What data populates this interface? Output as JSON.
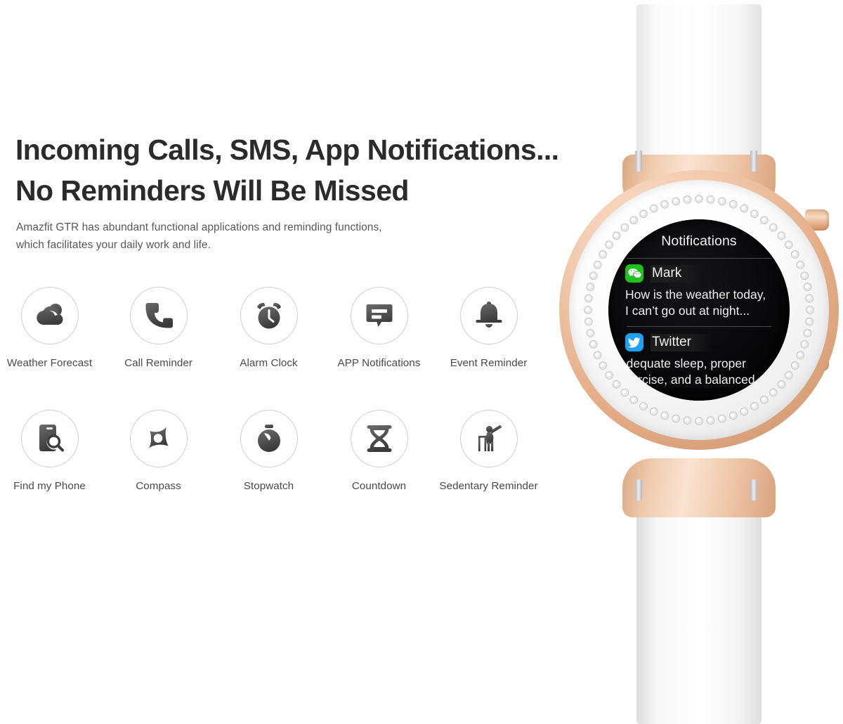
{
  "headline": {
    "line1": "Incoming Calls, SMS, App Notifications...",
    "line2": "No Reminders Will Be Missed"
  },
  "subcopy": {
    "line1": "Amazfit GTR has abundant functional applications and reminding functions,",
    "line2": "which facilitates your daily work and life."
  },
  "features": {
    "row1": [
      {
        "label": "Weather Forecast",
        "icon": "cloud-sun-icon"
      },
      {
        "label": "Call Reminder",
        "icon": "phone-handset-icon"
      },
      {
        "label": "Alarm Clock",
        "icon": "alarm-clock-icon"
      },
      {
        "label": "APP Notifications",
        "icon": "message-bubble-icon"
      },
      {
        "label": "Event Reminder",
        "icon": "bell-icon"
      }
    ],
    "row2": [
      {
        "label": "Find my Phone",
        "icon": "phone-search-icon"
      },
      {
        "label": "Compass",
        "icon": "compass-icon"
      },
      {
        "label": "Stopwatch",
        "icon": "stopwatch-icon"
      },
      {
        "label": "Countdown",
        "icon": "hourglass-icon"
      },
      {
        "label": "Sedentary Reminder",
        "icon": "sedentary-person-icon"
      }
    ]
  },
  "watch": {
    "screen": {
      "title": "Notifications",
      "notifications": [
        {
          "app": "WeChat",
          "app_icon": "wechat-icon",
          "sender": "Mark",
          "body_line1": "How is the weather today,",
          "body_line2": "I can’t go out at night...",
          "badge_color": "#1fc11f"
        },
        {
          "app": "Twitter",
          "app_icon": "twitter-bird-icon",
          "sender": "Twitter",
          "body_line1": "Adequate sleep, proper",
          "body_line2": "exercise, and a balanced",
          "badge_color": "#1da1f2"
        }
      ]
    },
    "hardware": {
      "case_color": "#e4ae88",
      "bezel_color": "#fafafa",
      "strap_color": "#fdfdfd",
      "crown_color": "#e6b38d"
    }
  },
  "colors": {
    "background": "#ffffff",
    "headline_text": "#2b2b2b",
    "body_text": "#58585a",
    "label_text": "#4a4a4c",
    "circle_stroke": "#cfcfcf",
    "icon_dark": "#4a4a4a"
  }
}
